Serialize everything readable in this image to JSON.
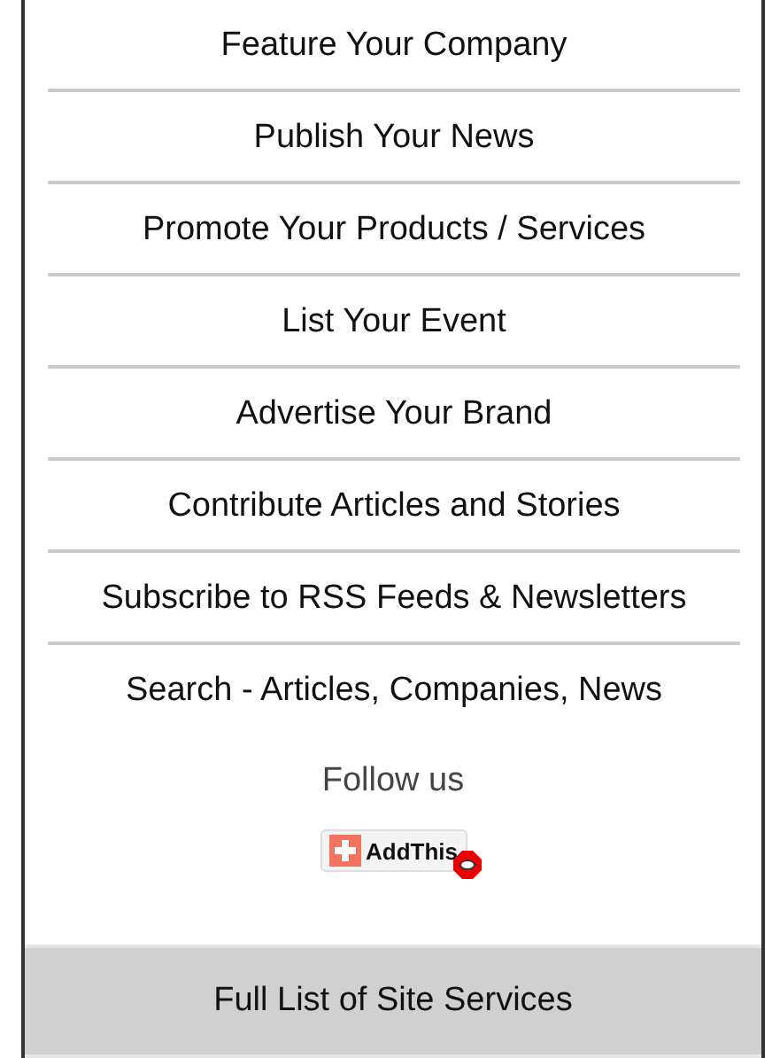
{
  "menu": [
    {
      "label": "Feature Your Company"
    },
    {
      "label": "Publish Your News"
    },
    {
      "label": "Promote Your Products / Services"
    },
    {
      "label": "List Your Event"
    },
    {
      "label": "Advertise Your Brand"
    },
    {
      "label": "Contribute Articles and Stories"
    },
    {
      "label": "Subscribe to RSS Feeds & Newsletters"
    },
    {
      "label": "Search - Articles, Companies, News"
    }
  ],
  "follow": {
    "heading": "Follow us",
    "button": "AddThis"
  },
  "footer_button": "Full List of Site Services"
}
